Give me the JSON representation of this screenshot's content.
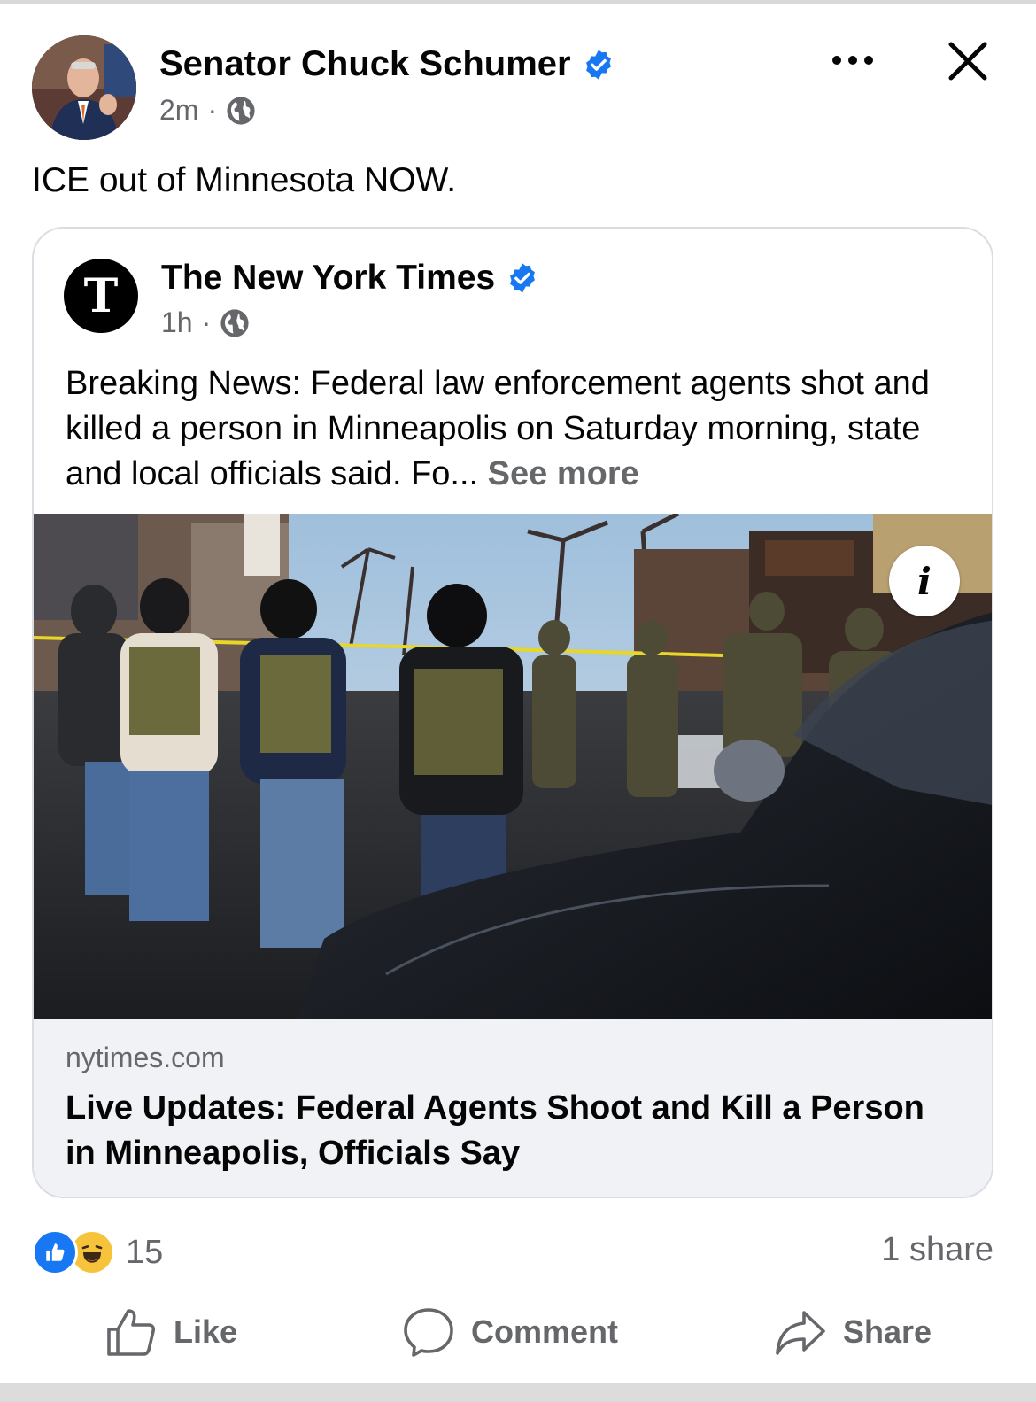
{
  "post": {
    "author": "Senator Chuck Schumer",
    "time": "2m",
    "separator": "·",
    "text": "ICE out of Minnesota NOW."
  },
  "shared": {
    "source": "The New York Times",
    "logo_letter": "T",
    "time": "1h",
    "separator": "·",
    "text": "Breaking News: Federal law enforcement agents shot and killed a person in Minneapolis on Saturday morning, state and local officials said. Fo...",
    "see_more": "See more",
    "info_label": "i",
    "link": {
      "domain": "nytimes.com",
      "headline": "Live Updates: Federal Agents Shoot and Kill a Person in Minneapolis, Officials Say"
    }
  },
  "engagement": {
    "reaction_count": "15",
    "shares": "1 share"
  },
  "actions": {
    "like": "Like",
    "comment": "Comment",
    "share": "Share"
  },
  "icons": {
    "verified": "verified-badge-icon",
    "globe": "globe-icon",
    "more": "more-options-icon",
    "close": "close-icon"
  },
  "colors": {
    "verified_blue": "#1877f2",
    "secondary_text": "#65676b",
    "link_footer_bg": "#f0f2f5"
  }
}
